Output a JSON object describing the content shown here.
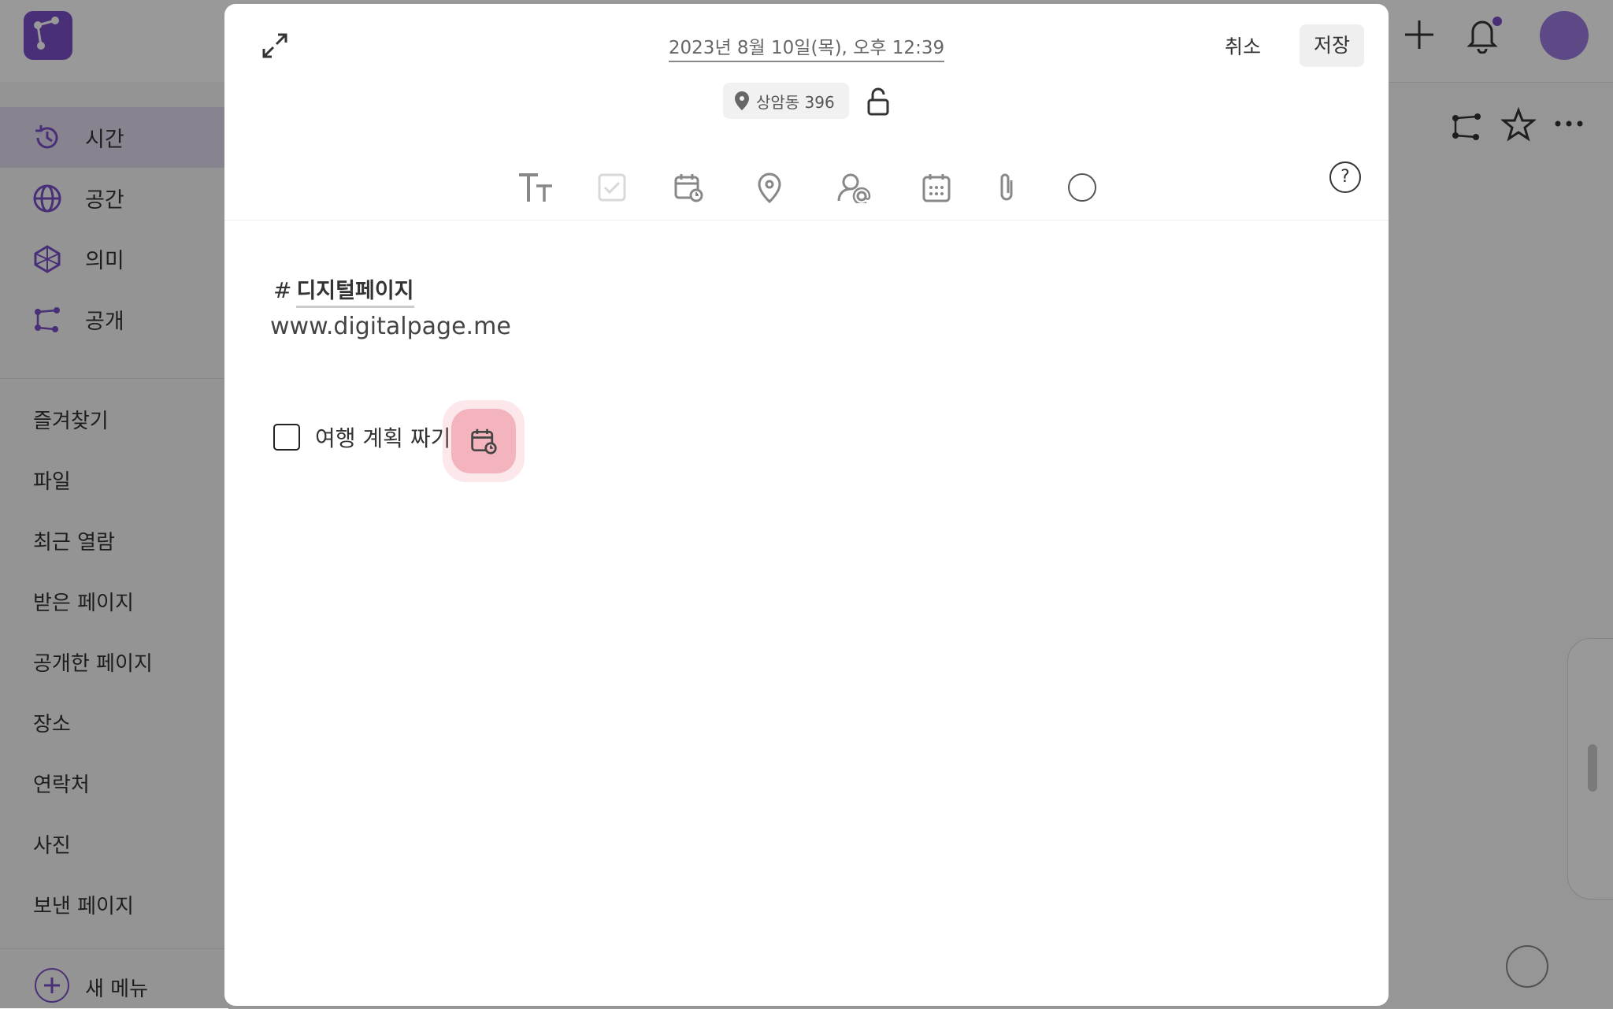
{
  "sidebar": {
    "main_items": [
      {
        "label": "시간",
        "icon": "history-icon",
        "active": true
      },
      {
        "label": "공간",
        "icon": "globe-icon",
        "active": false
      },
      {
        "label": "의미",
        "icon": "network-icon",
        "active": false
      },
      {
        "label": "공개",
        "icon": "share-icon",
        "active": false
      }
    ],
    "sub_items": [
      "즐겨찾기",
      "파일",
      "최근 열람",
      "받은 페이지",
      "공개한 페이지",
      "장소",
      "연락처",
      "사진",
      "보낸 페이지"
    ],
    "new_menu_label": "새 메뉴"
  },
  "modal": {
    "date": "2023년 8월 10일(목), 오후 12:39",
    "cancel_label": "취소",
    "save_label": "저장",
    "location": "상암동 396",
    "help_label": "?",
    "tag": "디지털페이지",
    "hash": "#",
    "url": "www.digitalpage.me",
    "todo_text": "여행 계획 짜기"
  },
  "colors": {
    "brand": "#7b4fc9",
    "highlight": "#f4b4bd"
  }
}
